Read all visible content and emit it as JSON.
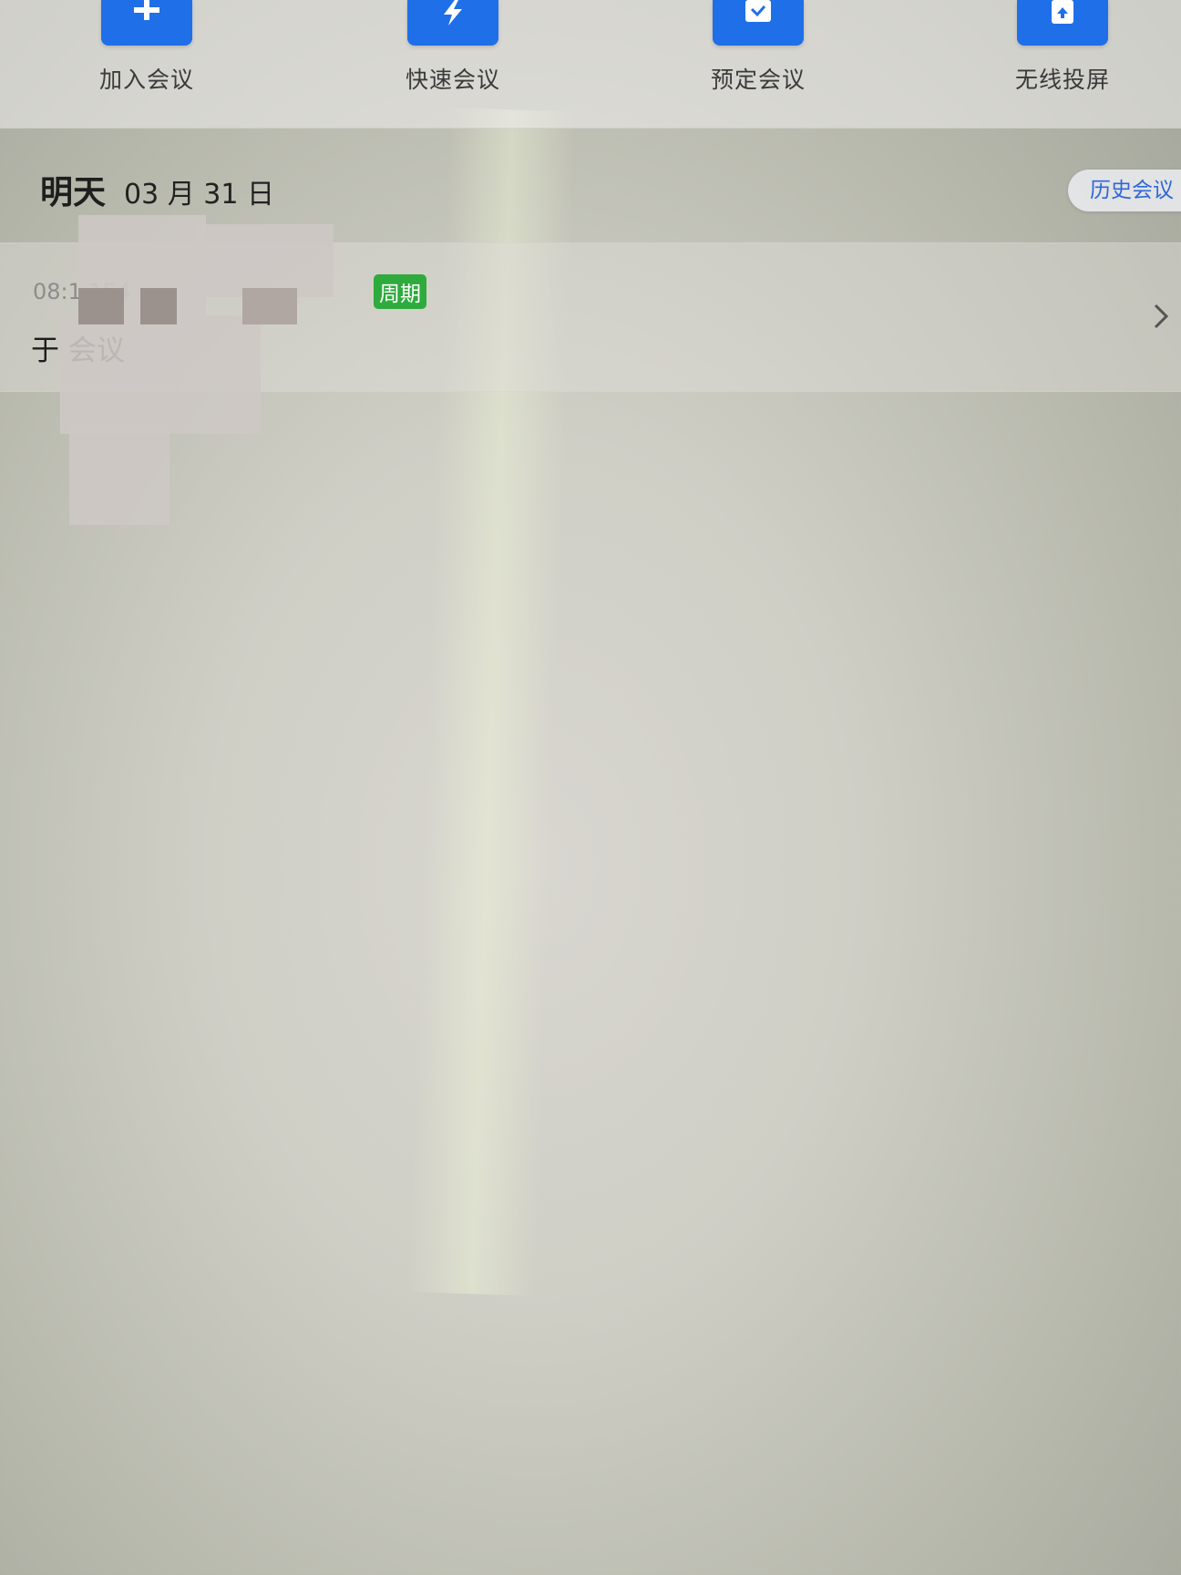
{
  "actions": [
    {
      "label": "加入会议",
      "icon": "plus-icon"
    },
    {
      "label": "快速会议",
      "icon": "lightning-icon"
    },
    {
      "label": "预定会议",
      "icon": "calendar-check-icon"
    },
    {
      "label": "无线投屏",
      "icon": "screen-cast-icon"
    }
  ],
  "schedule": {
    "day_label": "明天",
    "date": "03 月 31 日",
    "history_label": "历史会议"
  },
  "meeting": {
    "time": "08:1          154",
    "tag": "周期",
    "title": "于          会议",
    "chevron_icon": "chevron-right-icon"
  },
  "colors": {
    "accent_blue": "#1f6fe8",
    "tag_green": "#2eab3c",
    "link_blue": "#2f66d8"
  }
}
